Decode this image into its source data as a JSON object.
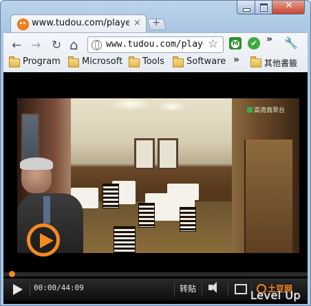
{
  "tab": {
    "title": "www.tudou.com/player...",
    "close": "×",
    "new_tab": "+"
  },
  "window_controls": {
    "close": "✕"
  },
  "toolbar": {
    "back_icon": "←",
    "forward_icon": "→",
    "reload_icon": "↻",
    "home_icon": "⌂",
    "url": "www.tudou.com/playe",
    "star_icon": "☆",
    "ext_m": "M",
    "ext_check": "✔",
    "overflow": "»",
    "wrench_icon": "🔧"
  },
  "bookmarks": {
    "items": [
      "Program",
      "Microsoft",
      "Tools",
      "Software"
    ],
    "overflow": "»",
    "other": "其他書籤"
  },
  "video": {
    "channel_logo": "高清翡翠台"
  },
  "player": {
    "time": "00:00/44:09",
    "share": "转贴",
    "brand": "土豆网"
  },
  "watermark": "Level Up"
}
